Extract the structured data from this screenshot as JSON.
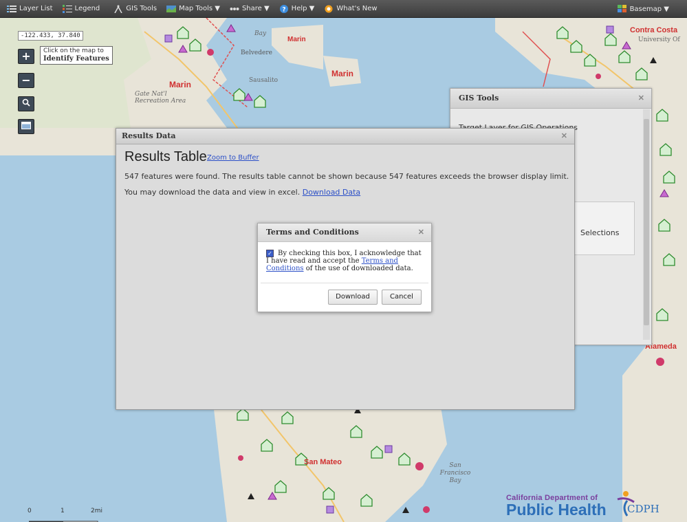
{
  "toolbar": {
    "layer_list": "Layer List",
    "legend": "Legend",
    "gis_tools": "GIS Tools",
    "map_tools": "Map Tools ▼",
    "share": "Share ▼",
    "help": "Help ▼",
    "whats_new": "What's New",
    "basemap": "Basemap ▼"
  },
  "map": {
    "coordinates": "-122.433, 37.840",
    "identify_tip_line1": "Click on the map to",
    "identify_tip_line2": "Identify Features",
    "labels": {
      "marin1": "Marin",
      "marin2": "Marin",
      "marin3": "Marin",
      "belvedere": "Belvedere",
      "bay": "Bay",
      "contra_costa": "Contra Costa",
      "university": "University Of",
      "alameda": "Alameda",
      "san_mateo": "San Mateo",
      "sf_bay": "San Francisco Bay",
      "sausalito": "Sausalito",
      "gate": "Gate Nat'l Recreation Area"
    },
    "scale_labels": [
      "0",
      "1",
      "2mi"
    ]
  },
  "gis_panel": {
    "title": "GIS Tools",
    "target_text": "Target Layer for GIS Operations",
    "selections": "Selections"
  },
  "results": {
    "header": "Results Data",
    "title": "Results Table",
    "zoom_link": "Zoom to Buffer",
    "message": "547 features were found. The results table cannot be shown because 547 features exceeds the browser display limit.",
    "download_prefix": "You may download the data and view in excel.",
    "download_link": "Download Data"
  },
  "terms": {
    "title": "Terms and Conditions",
    "text_part1": "By checking this box, I acknowledge that I have read and accept the",
    "link": "Terms and Conditions",
    "text_part2": "of the use of downloaded data.",
    "checked": true,
    "download_button": "Download",
    "cancel_button": "Cancel"
  },
  "branding": {
    "line1": "California Department of",
    "line2": "Public Health",
    "abbr": "CDPH"
  },
  "colors": {
    "toolbar": "#444444",
    "link": "#2b4fc7",
    "map_water": "#a9cbe2",
    "map_land": "#e8e4d8",
    "feature_green": "#3a9a3a",
    "feature_magenta": "#d0306a",
    "feature_purple": "#9a5ad0"
  }
}
